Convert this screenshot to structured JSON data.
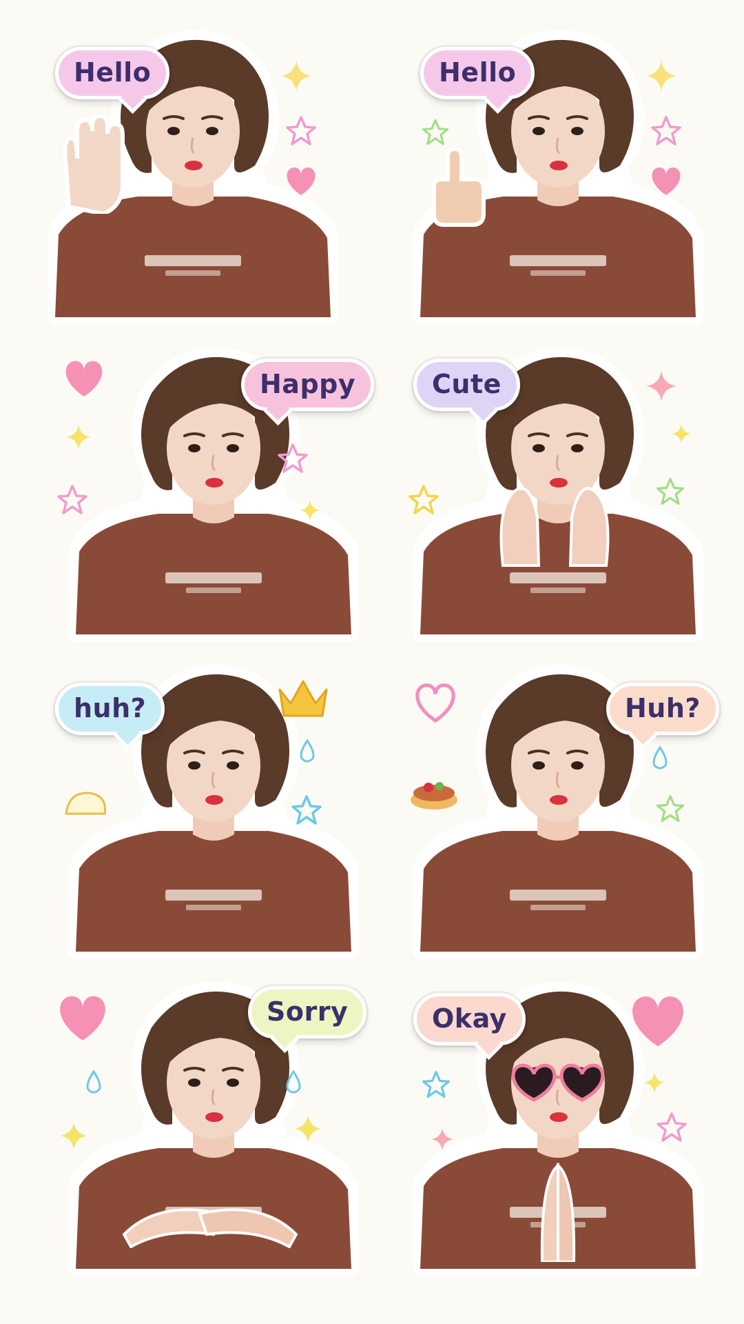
{
  "colors": {
    "background": "#fbfaf5",
    "shirt": "#8a4a38",
    "hair": "#5a3a28",
    "skin": "#f3d7c6"
  },
  "stickers": [
    {
      "label": "Hello",
      "bubble_color": "#f5c8ea"
    },
    {
      "label": "Hello",
      "bubble_color": "#f5c8ea"
    },
    {
      "label": "Happy",
      "bubble_color": "#f7c3dc"
    },
    {
      "label": "Cute",
      "bubble_color": "#ddd4f6"
    },
    {
      "label": "huh?",
      "bubble_color": "#c6ecf5"
    },
    {
      "label": "Huh?",
      "bubble_color": "#fbdccb"
    },
    {
      "label": "Sorry",
      "bubble_color": "#ecf6c2"
    },
    {
      "label": "Okay",
      "bubble_color": "#fbd9cf"
    }
  ]
}
